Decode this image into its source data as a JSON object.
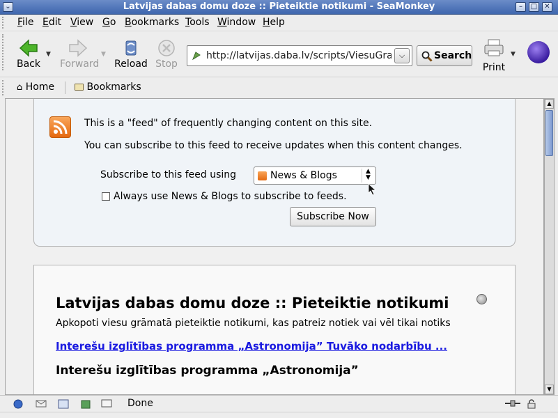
{
  "window": {
    "title": "Latvijas dabas domu doze :: Pieteiktie notikumi - SeaMonkey"
  },
  "menu": {
    "items": [
      {
        "label": "File",
        "key": "F"
      },
      {
        "label": "Edit",
        "key": "E"
      },
      {
        "label": "View",
        "key": "V"
      },
      {
        "label": "Go",
        "key": "G"
      },
      {
        "label": "Bookmarks",
        "key": "B"
      },
      {
        "label": "Tools",
        "key": "T"
      },
      {
        "label": "Window",
        "key": "W"
      },
      {
        "label": "Help",
        "key": "H"
      }
    ]
  },
  "nav": {
    "back": "Back",
    "forward": "Forward",
    "reload": "Reload",
    "stop": "Stop",
    "url": "http://latvijas.daba.lv/scripts/ViesuGramata",
    "search": "Search",
    "print": "Print"
  },
  "personal": {
    "home": "Home",
    "bookmarks": "Bookmarks"
  },
  "feed": {
    "line1": "This is a \"feed\" of frequently changing content on this site.",
    "line2": "You can subscribe to this feed to receive updates when this content changes.",
    "subscribe_label": "Subscribe to this feed using",
    "reader_option": "News & Blogs",
    "always_text": "Always use News & Blogs to subscribe to feeds.",
    "always_checked": false,
    "subscribe_button": "Subscribe Now"
  },
  "page": {
    "title": "Latvijas dabas domu doze :: Pieteiktie notikumi",
    "subtitle": "Apkopoti viesu grāmatā pieteiktie notikumi, kas patreiz notiek vai vēl tikai notiks",
    "link": "Interešu izglītības programma „Astronomija” Tuvāko nodarbību ...",
    "heading": "Interešu izglītības programma „Astronomija”"
  },
  "status": {
    "text": "Done"
  },
  "colors": {
    "titlebar": "#3e66ae",
    "link": "#1a1ae0",
    "rss": "#e56a10"
  }
}
